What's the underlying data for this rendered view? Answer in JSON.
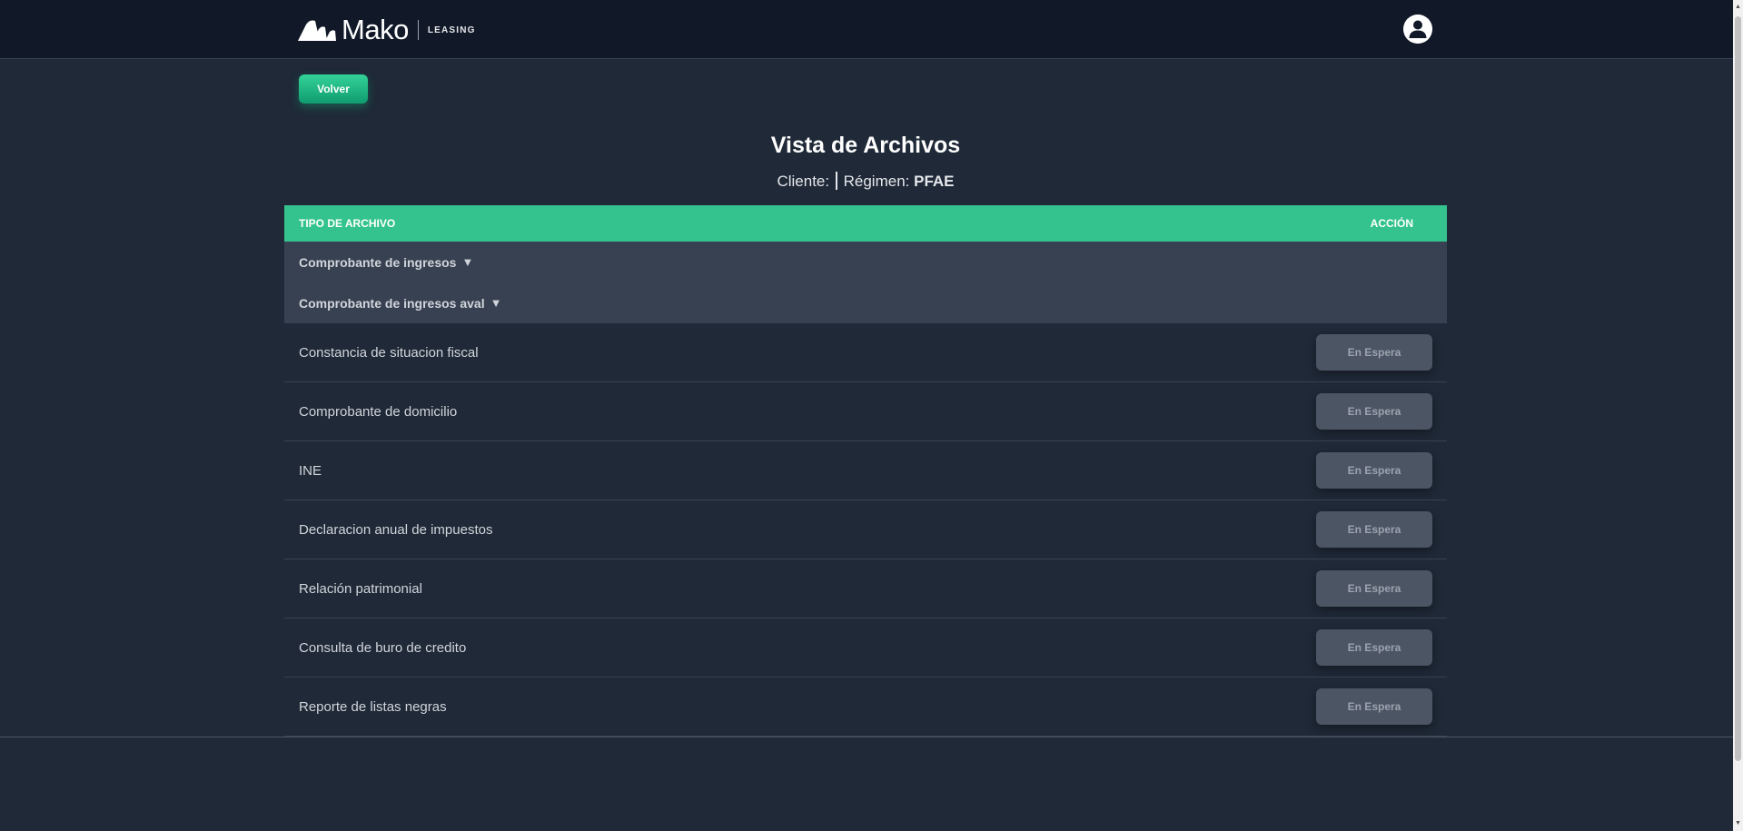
{
  "header": {
    "brand_name": "Mako",
    "brand_sub": "LEASING",
    "profile_icon": "user-icon"
  },
  "main": {
    "back_label": "Volver",
    "title": "Vista de Archivos",
    "client_label": "Cliente:",
    "regimen_label": "Régimen:",
    "regimen_value": "PFAE"
  },
  "table": {
    "col_type": "TIPO DE ARCHIVO",
    "col_action": "ACCIÓN",
    "groups": [
      {
        "label": "Comprobante de ingresos",
        "caret": "▼"
      },
      {
        "label": "Comprobante de ingresos aval",
        "caret": "▼"
      }
    ],
    "rows": [
      {
        "label": "Constancia de situacion fiscal",
        "status": "En Espera"
      },
      {
        "label": "Comprobante de domicilio",
        "status": "En Espera"
      },
      {
        "label": "INE",
        "status": "En Espera"
      },
      {
        "label": "Declaracion anual de impuestos",
        "status": "En Espera"
      },
      {
        "label": "Relación patrimonial",
        "status": "En Espera"
      },
      {
        "label": "Consulta de buro de credito",
        "status": "En Espera"
      },
      {
        "label": "Reporte de listas negras",
        "status": "En Espera"
      }
    ]
  },
  "colors": {
    "accent": "#34c38f",
    "background": "#1f2937",
    "topbar": "#111827",
    "disabled_button": "#4b5563"
  }
}
